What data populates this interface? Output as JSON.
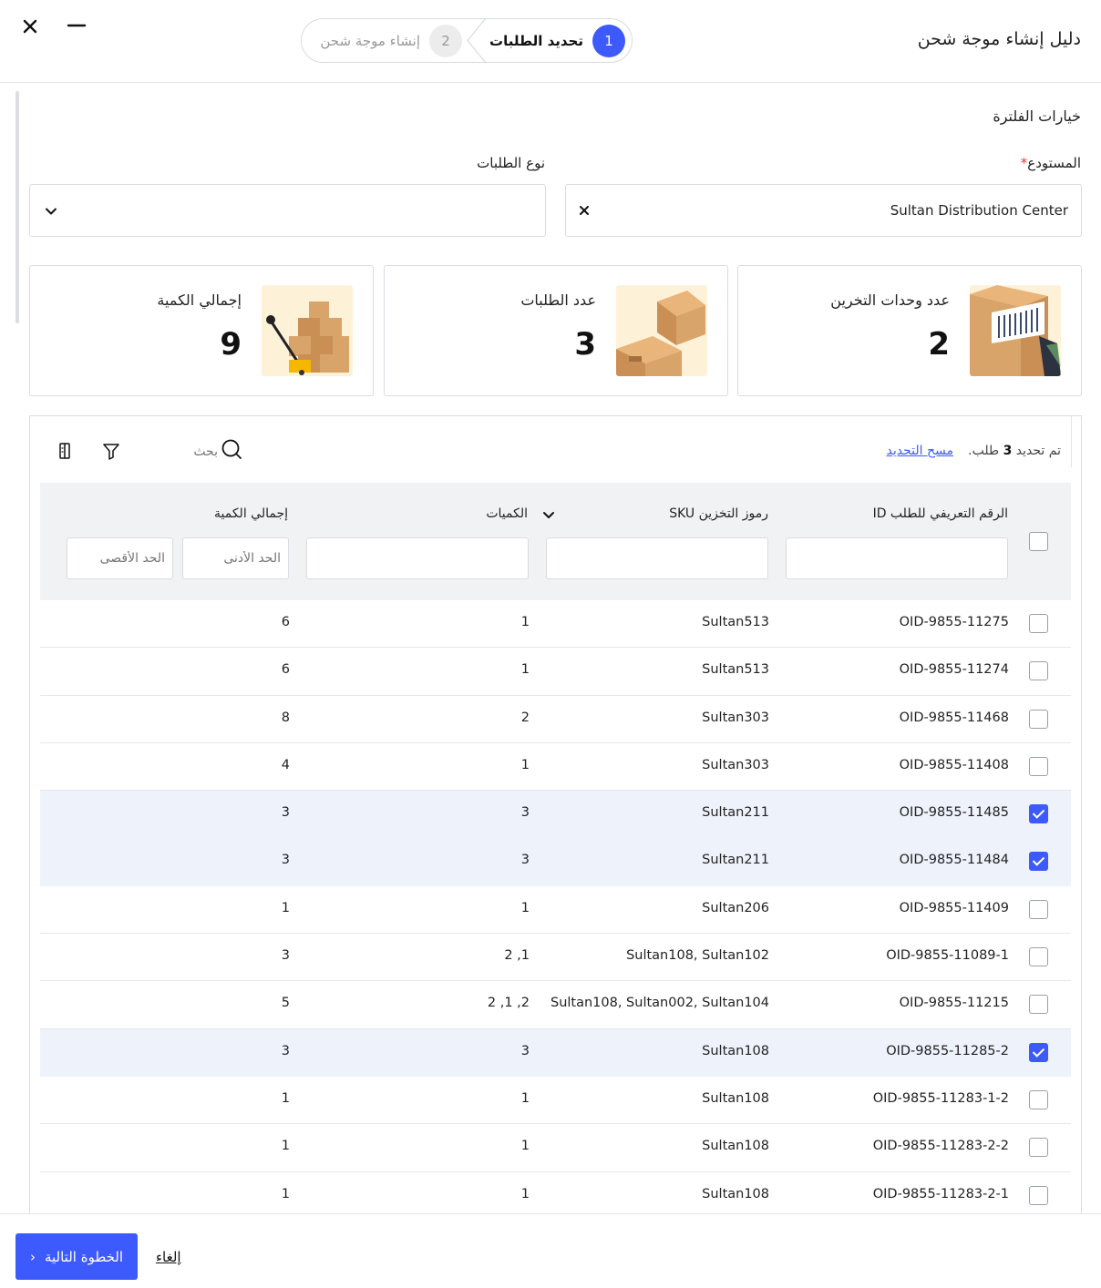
{
  "header": {
    "title": "دليل إنشاء موجة شحن",
    "steps": [
      {
        "num": "1",
        "label": "تحديد الطلبات"
      },
      {
        "num": "2",
        "label": "إنشاء موجة شحن"
      }
    ]
  },
  "filters": {
    "title": "خيارات الفلترة",
    "warehouse_label": "المستودع",
    "warehouse_value": "Sultan Distribution Center",
    "order_type_label": "نوع الطلبات",
    "order_type_value": ""
  },
  "stats": {
    "sku_label": "عدد وحدات التخرين",
    "sku_value": "2",
    "orders_label": "عدد الطلبات",
    "orders_value": "3",
    "total_label": "إجمالي الكمية",
    "total_value": "9"
  },
  "toolbar": {
    "selected_prefix": "تم تحديد",
    "selected_count": "3",
    "selected_suffix": "طلب.",
    "clear_selection": "مسح التحديد",
    "search_placeholder": "بحث"
  },
  "table": {
    "headers": {
      "id": "الرقم التعريفي للطلب ID",
      "sku": "رموز التخزين SKU",
      "qty": "الكميات",
      "total": "إجمالي الكمية",
      "min_placeholder": "الحد الأدنى",
      "max_placeholder": "الحد الأقصى"
    },
    "rows": [
      {
        "id": "OID-9855-11275",
        "sku": "Sultan513",
        "qty": "1",
        "total": "6",
        "selected": false
      },
      {
        "id": "OID-9855-11274",
        "sku": "Sultan513",
        "qty": "1",
        "total": "6",
        "selected": false
      },
      {
        "id": "OID-9855-11468",
        "sku": "Sultan303",
        "qty": "2",
        "total": "8",
        "selected": false
      },
      {
        "id": "OID-9855-11408",
        "sku": "Sultan303",
        "qty": "1",
        "total": "4",
        "selected": false
      },
      {
        "id": "OID-9855-11485",
        "sku": "Sultan211",
        "qty": "3",
        "total": "3",
        "selected": true
      },
      {
        "id": "OID-9855-11484",
        "sku": "Sultan211",
        "qty": "3",
        "total": "3",
        "selected": true
      },
      {
        "id": "OID-9855-11409",
        "sku": "Sultan206",
        "qty": "1",
        "total": "1",
        "selected": false
      },
      {
        "id": "OID-9855-11089-1",
        "sku": "Sultan108, Sultan102",
        "qty": "2 ,1",
        "total": "3",
        "selected": false
      },
      {
        "id": "OID-9855-11215",
        "sku": "Sultan108, Sultan002, Sultan104",
        "qty": "2 ,1 ,2",
        "total": "5",
        "selected": false
      },
      {
        "id": "OID-9855-11285-2",
        "sku": "Sultan108",
        "qty": "3",
        "total": "3",
        "selected": true
      },
      {
        "id": "OID-9855-11283-1-2",
        "sku": "Sultan108",
        "qty": "1",
        "total": "1",
        "selected": false
      },
      {
        "id": "OID-9855-11283-2-2",
        "sku": "Sultan108",
        "qty": "1",
        "total": "1",
        "selected": false
      },
      {
        "id": "OID-9855-11283-2-1",
        "sku": "Sultan108",
        "qty": "1",
        "total": "1",
        "selected": false
      }
    ]
  },
  "footer": {
    "next_label": "الخطوة التالية",
    "cancel_label": "إلغاء"
  },
  "colors": {
    "accent": "#3d5afe",
    "selected_row": "#eef2fb",
    "required": "#e53935"
  }
}
